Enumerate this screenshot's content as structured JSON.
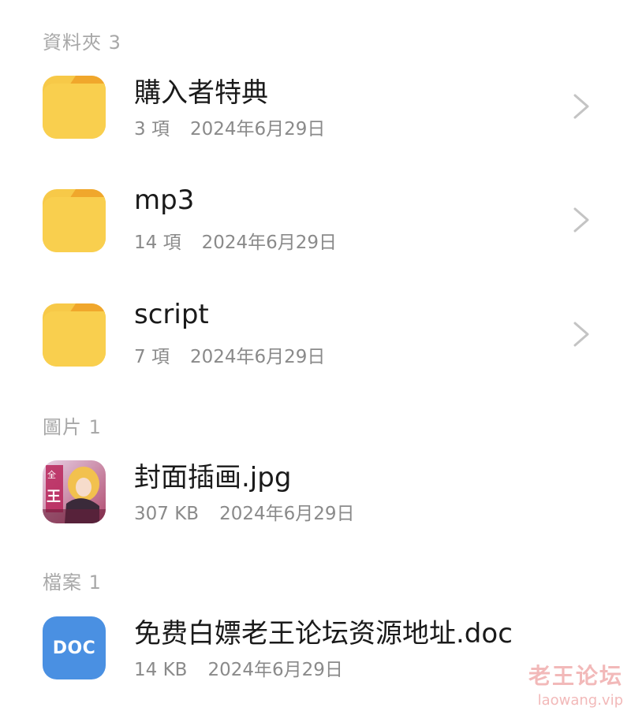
{
  "sections": {
    "folders": {
      "header": "資料夾 3"
    },
    "images": {
      "header": "圖片 1"
    },
    "files": {
      "header": "檔案 1"
    }
  },
  "folders": [
    {
      "name": "購入者特典",
      "count": "3 項",
      "date": "2024年6月29日"
    },
    {
      "name": "mp3",
      "count": "14 項",
      "date": "2024年6月29日"
    },
    {
      "name": "script",
      "count": "7 項",
      "date": "2024年6月29日"
    }
  ],
  "images": [
    {
      "name": "封面插画.jpg",
      "size": "307 KB",
      "date": "2024年6月29日"
    }
  ],
  "files": [
    {
      "name": "免费白嫖老王论坛资源地址.doc",
      "size": "14 KB",
      "date": "2024年6月29日",
      "icon_label": "DOC"
    }
  ],
  "watermark": {
    "line1": "老王论坛",
    "line2": "laowang.vip"
  },
  "colors": {
    "folder": "#f7c948",
    "folder_tab": "#f0a72c",
    "doc_icon": "#4a90e2",
    "header_text": "#a8a8a8",
    "title_text": "#1a1a1a",
    "meta_text": "#8a8a8a",
    "watermark": "#f2b9b9"
  },
  "icons": {
    "folder": "folder-icon",
    "chevron": "chevron-right-icon",
    "image": "image-thumbnail",
    "doc": "doc-file-icon"
  }
}
